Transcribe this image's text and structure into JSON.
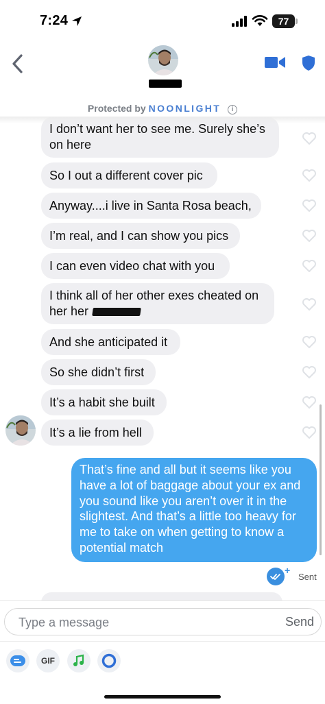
{
  "status": {
    "time": "7:24",
    "battery": "77"
  },
  "header": {
    "protected_prefix": "Protected by",
    "protected_brand": "NOONLIGHT"
  },
  "messages": [
    {
      "line1": "I don’t want her to see me. Surely she’s",
      "line2": "on here"
    },
    {
      "text": "So I out a different cover pic"
    },
    {
      "text": "Anyway....i live in Santa Rosa beach,"
    },
    {
      "text": "I’m real, and I can show you pics"
    },
    {
      "text": "I can even video chat with you"
    },
    {
      "line1": "I think all of her other exes cheated on",
      "line2": "her her"
    },
    {
      "text": "And she anticipated it"
    },
    {
      "text": "So she didn’t first"
    },
    {
      "text": "It’s a habit she built"
    },
    {
      "text": "It’s a lie from hell"
    }
  ],
  "sent_message": {
    "lines": [
      "That’s fine and all but it seems like you",
      "have a lot of baggage about your ex and",
      "you sound like you aren’t over it in the",
      "slightest. And that’s a little too heavy for",
      "me to take on when getting to know a",
      "potential match"
    ],
    "status": "Sent"
  },
  "composer": {
    "placeholder": "Type a message",
    "send_label": "Send",
    "gif_label": "GIF"
  },
  "colors": {
    "accent_blue": "#45a6ef",
    "received_bubble": "#efeff2",
    "brand_blue": "#4a7fd1"
  }
}
